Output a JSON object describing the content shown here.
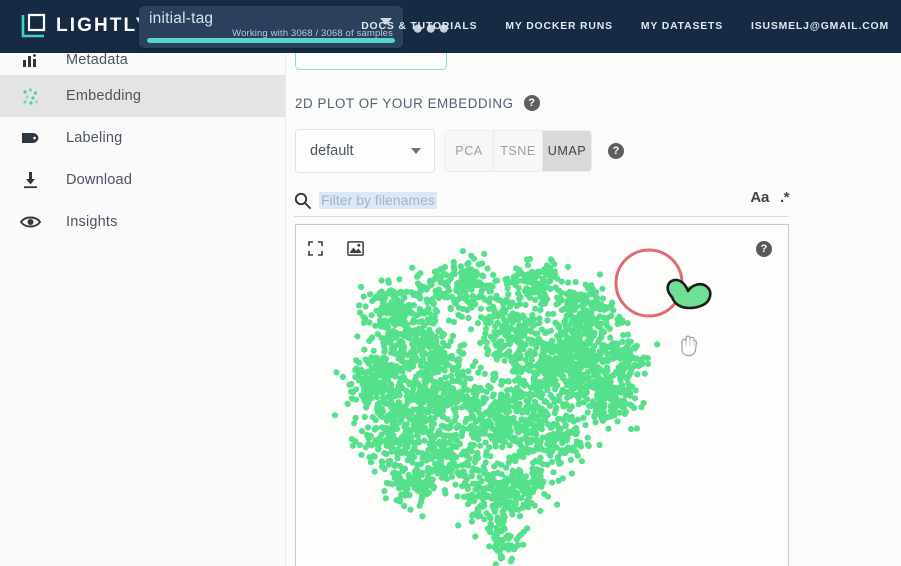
{
  "header": {
    "brand": "LIGHTLY",
    "brand_icon": "lightly-logo-icon",
    "tag": {
      "name": "initial-tag",
      "status": "Working with 3068 / 3068 of samples",
      "progress_percent": 100,
      "caret_icon": "chevron-down-icon",
      "menu_icon": "ellipsis-icon"
    },
    "nav": [
      {
        "label": "DOCS & TUTORIALS",
        "name": "nav-docs-tutorials"
      },
      {
        "label": "MY DOCKER RUNS",
        "name": "nav-my-docker-runs"
      },
      {
        "label": "MY DATASETS",
        "name": "nav-my-datasets"
      },
      {
        "label": "ISUSMELJ@GMAIL.COM",
        "name": "nav-account-email"
      }
    ]
  },
  "sidebar": {
    "items": [
      {
        "label": "Metadata",
        "icon": "bar-chart-icon",
        "active": false
      },
      {
        "label": "Embedding",
        "icon": "scatter-dots-icon",
        "active": true
      },
      {
        "label": "Labeling",
        "icon": "tag-icon",
        "active": false
      },
      {
        "label": "Download",
        "icon": "download-icon",
        "active": false
      },
      {
        "label": "Insights",
        "icon": "eye-icon",
        "active": false
      }
    ]
  },
  "main": {
    "section_title": "2D PLOT OF YOUR EMBEDDING",
    "section_help_icon": "help-circle-icon",
    "embedding_select": {
      "value": "default",
      "caret_icon": "chevron-down-icon"
    },
    "projection_buttons": [
      {
        "label": "PCA",
        "selected": false
      },
      {
        "label": "TSNE",
        "selected": false
      },
      {
        "label": "UMAP",
        "selected": true
      }
    ],
    "projection_help_icon": "help-circle-icon",
    "search": {
      "placeholder": "Filter by filenames",
      "value": "",
      "icon": "search-icon",
      "match_case_label": "Aa",
      "regex_label": ".*"
    },
    "plot": {
      "toolbar": [
        {
          "icon": "fullscreen-icon",
          "name": "plot-fullscreen-button"
        },
        {
          "icon": "screenshot-icon",
          "name": "plot-screenshot-button"
        }
      ],
      "help_icon": "help-circle-icon",
      "cursor_icon": "grab-hand-cursor",
      "point_color": "#55e08c",
      "annotation_circle_color": "#e06b72",
      "lasso_outline_color": "#1c1c1c",
      "lasso_fill_color": "#6fdf95"
    }
  },
  "colors": {
    "header_bg": "#162a44",
    "accent_teal": "#56d6c8",
    "sidebar_bg": "#fafafa",
    "active_item_bg": "#e4e4e4",
    "scatter_green": "#55e08c",
    "annotation_red": "#e06b72"
  }
}
